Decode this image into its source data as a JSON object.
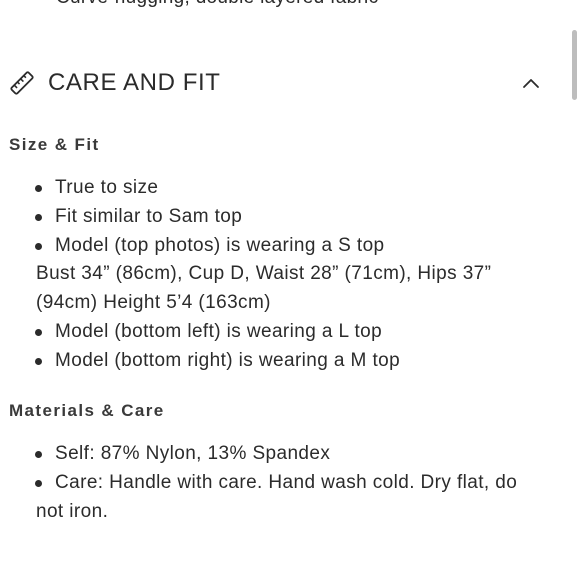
{
  "previous_item": "Curve-hugging, double layered fabric",
  "accordion": {
    "title": "CARE AND FIT",
    "icon": "ruler-icon",
    "toggle_icon": "chevron-up-icon"
  },
  "size_fit": {
    "heading": "Size & Fit",
    "lines": [
      {
        "text": "True to size",
        "bullet": true
      },
      {
        "text": "Fit similar to Sam top",
        "bullet": true
      },
      {
        "text": "Model (top photos) is wearing a S top",
        "bullet": true
      },
      {
        "text": "Bust 34” (86cm), Cup D, Waist 28” (71cm), Hips 37”",
        "bullet": false
      },
      {
        "text": "(94cm) Height 5’4 (163cm)",
        "bullet": false
      },
      {
        "text": "Model (bottom left) is wearing a L top",
        "bullet": true
      },
      {
        "text": "Model (bottom right) is wearing a M top",
        "bullet": true
      }
    ]
  },
  "materials_care": {
    "heading": "Materials & Care",
    "lines": [
      {
        "text": "Self: 87% Nylon, 13% Spandex",
        "bullet": true
      },
      {
        "text": "Care: Handle with care. Hand wash cold. Dry flat, do",
        "bullet": true
      },
      {
        "text": "not iron.",
        "bullet": false
      }
    ]
  }
}
